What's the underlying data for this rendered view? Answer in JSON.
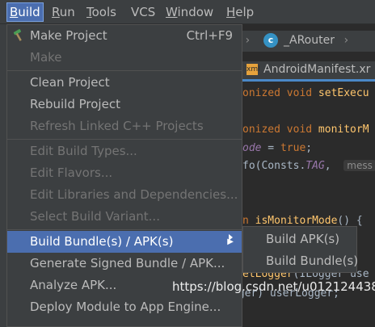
{
  "menubar": {
    "items": [
      {
        "label": "Build",
        "mnemonic": "B",
        "rest": "uild"
      },
      {
        "label": "Run",
        "mnemonic": "R",
        "rest": "un"
      },
      {
        "label": "Tools",
        "mnemonic": "T",
        "rest": "ools"
      },
      {
        "label": "VCS",
        "mnemonic": "",
        "rest": "VCS"
      },
      {
        "label": "Window",
        "mnemonic": "W",
        "rest": "indow"
      },
      {
        "label": "Help",
        "mnemonic": "H",
        "rest": "elp"
      }
    ]
  },
  "build_menu": {
    "items": [
      {
        "label": "Make Project",
        "shortcut": "Ctrl+F9"
      },
      {
        "label": "Make"
      },
      {
        "label": "Clean Project"
      },
      {
        "label": "Rebuild Project"
      },
      {
        "label": "Refresh Linked C++ Projects"
      },
      {
        "label": "Edit Build Types..."
      },
      {
        "label": "Edit Flavors..."
      },
      {
        "label": "Edit Libraries and Dependencies..."
      },
      {
        "label": "Select Build Variant..."
      },
      {
        "label": "Build Bundle(s) / APK(s)"
      },
      {
        "label": "Generate Signed Bundle / APK..."
      },
      {
        "label": "Analyze APK..."
      },
      {
        "label": "Deploy Module to App Engine..."
      }
    ]
  },
  "submenu": {
    "items": [
      {
        "label": "Build APK(s)"
      },
      {
        "label": "Build Bundle(s)"
      }
    ]
  },
  "editor": {
    "breadcrumb_class": "_ARouter",
    "breadcrumb_class_icon": "c",
    "tab_title": "AndroidManifest.xr",
    "tab_icon": "xml",
    "code": {
      "l1_kw": "onized void",
      "l1_fn": " setExecu",
      "l2_kw": "onized void",
      "l2_fn": " monitorM",
      "l3_fld": "ode",
      "l3_rest": " = ",
      "l3_kw": "true",
      "l3_end": ";",
      "l4_start": "fo(Consts.",
      "l4_fld": "TAG",
      "l4_comma": ",",
      "l4_hint": "mess",
      "l5_kw": "n",
      "l5_fn": " isMonitorMode",
      "l5_end": "() {",
      "l6": "r",
      "l7_fn": "etLogger",
      "l7_rest": "(ILogger use",
      "l8": "= (ILogger) userLogger;"
    }
  },
  "watermark": "https://blog.csdn.net/u012124438",
  "colors": {
    "accent": "#4b6eaf",
    "menu_bg": "#3c3f41",
    "editor_bg": "#2b2b2b",
    "disabled_text": "#747474"
  }
}
